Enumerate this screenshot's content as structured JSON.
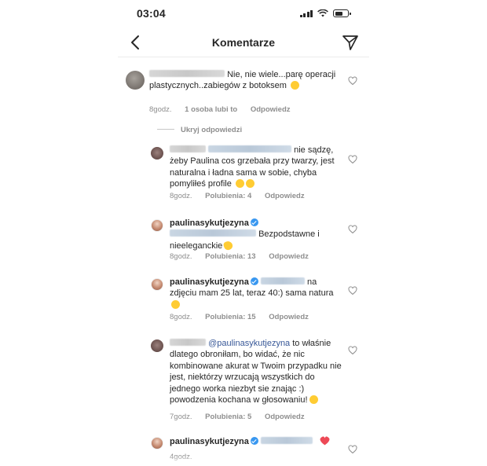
{
  "status_bar": {
    "time": "03:04"
  },
  "header": {
    "title": "Komentarze"
  },
  "comments": [
    {
      "text": "Nie, nie wiele...parę operacji plastycznych..zabiegów z botoksem",
      "time": "8godz.",
      "likes": "1 osoba lubi to",
      "reply": "Odpowiedz"
    }
  ],
  "hide_replies_label": "Ukryj odpowiedzi",
  "replies": [
    {
      "text": "nie sądzę, żeby Paulina cos grzebała przy twarzy, jest naturalna i ładna sama w sobie, chyba pomyliłeś profile",
      "time": "8godz.",
      "likes": "Polubienia: 4",
      "reply": "Odpowiedz"
    },
    {
      "username": "paulinasykutjezyna",
      "text": "Bezpodstawne i nieeleganckie",
      "time": "8godz.",
      "likes": "Polubienia: 13",
      "reply": "Odpowiedz"
    },
    {
      "username": "paulinasykutjezyna",
      "text_a": "na",
      "text_b": "zdjęciu mam 25 lat, teraz 40:) sama natura",
      "time": "8godz.",
      "likes": "Polubienia: 15",
      "reply": "Odpowiedz"
    },
    {
      "mention": "@paulinasykutjezyna",
      "text_a": "to",
      "text_b": "właśnie dlatego obroniłam, bo widać, że nic kombinowane akurat w Twoim przypadku nie jest, niektórzy wrzucają wszystkich do jednego worka niezbyt sie znając :) powodzenia kochana w głosowaniu!",
      "time": "7godz.",
      "likes": "Polubienia: 5",
      "reply": "Odpowiedz"
    },
    {
      "username": "paulinasykutjezyna",
      "time": "4godz."
    }
  ],
  "colors": {
    "text": "#262626",
    "meta": "#8e8e8e",
    "verified": "#3897f0",
    "mention": "#385898",
    "heart_red": "#ed4956"
  },
  "icons": [
    "back-arrow-icon",
    "send-icon",
    "heart-outline-icon",
    "verified-badge-icon",
    "red-heart-emoji"
  ]
}
